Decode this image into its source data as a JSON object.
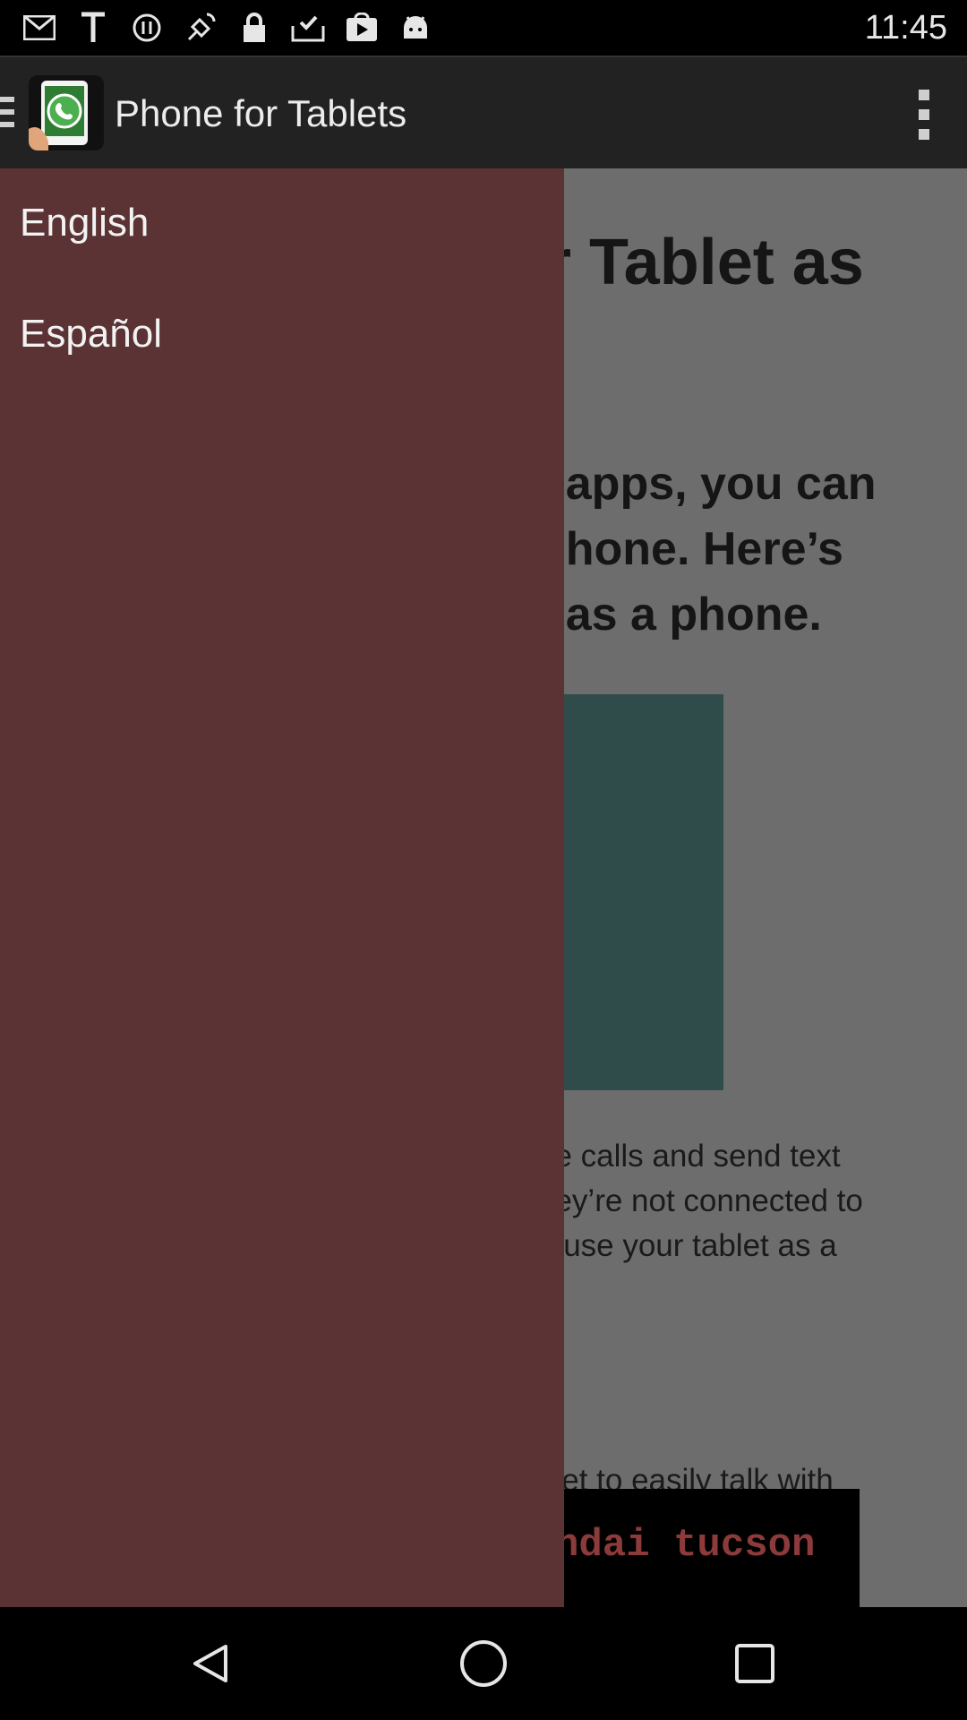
{
  "status_bar": {
    "time": "11:45",
    "icons": [
      "mail-icon",
      "text-t-icon",
      "sync-circle-icon",
      "gps-icon",
      "lock-icon",
      "inbox-check-icon",
      "play-store-icon",
      "android-icon"
    ]
  },
  "action_bar": {
    "title": "Phone for Tablets"
  },
  "drawer": {
    "items": [
      {
        "label": "English"
      },
      {
        "label": "Español"
      }
    ]
  },
  "content": {
    "heading_partial": "r Tablet as",
    "intro_lines": [
      "f apps, you can",
      "phone. Here’s",
      "t as a phone."
    ],
    "body1_lines": [
      "ne calls and send text",
      "ney’re not connected to",
      "o use your tablet as a"
    ],
    "body2_line": "blet to easily talk with",
    "ad_text": "ndai tucson"
  },
  "colors": {
    "drawer_bg": "#5b3335",
    "action_bar_bg": "#222222",
    "content_dim": "#6d6d6d",
    "image_bg": "#2f4b4a"
  }
}
